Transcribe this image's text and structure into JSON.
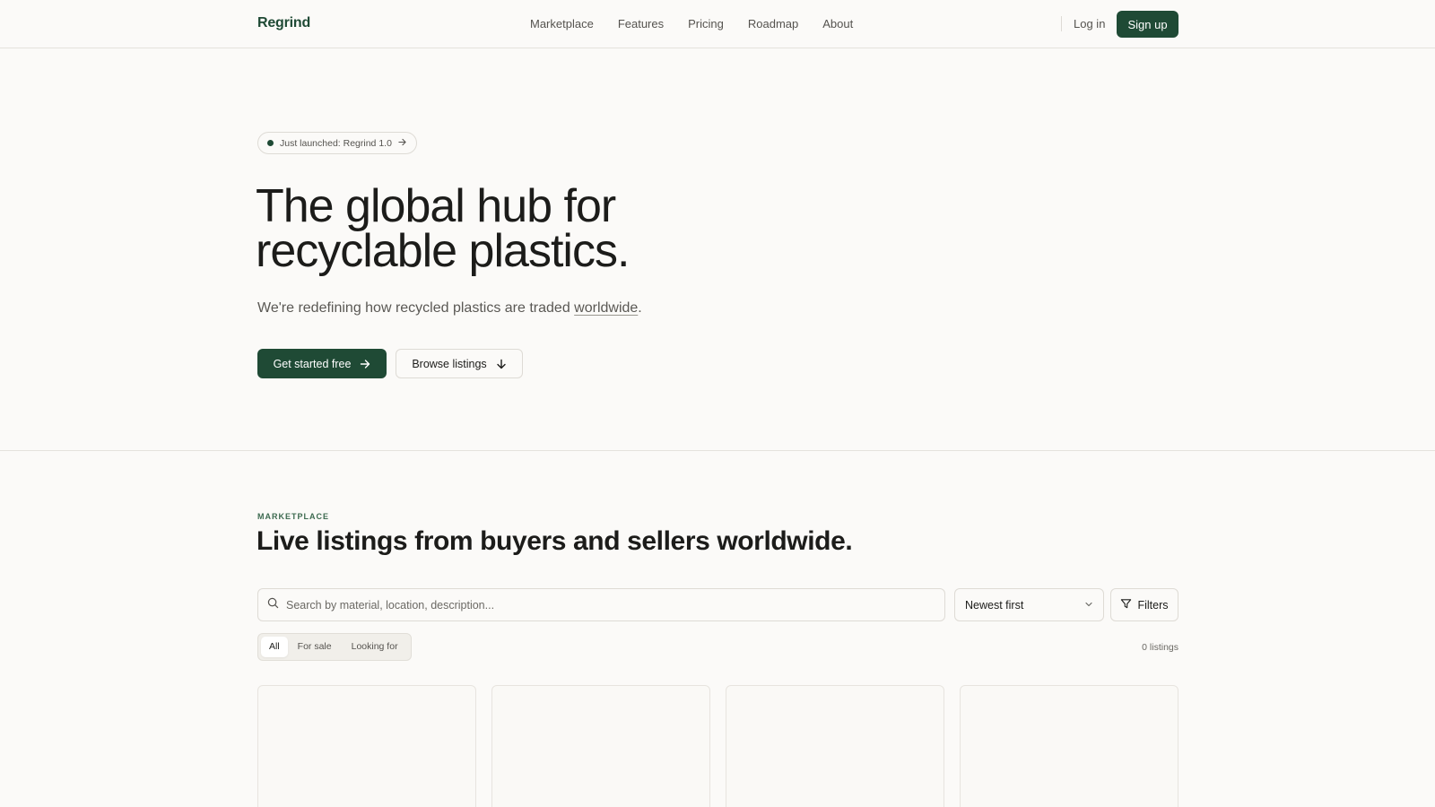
{
  "header": {
    "logo": "Regrind",
    "nav": [
      "Marketplace",
      "Features",
      "Pricing",
      "Roadmap",
      "About"
    ],
    "login_label": "Log in",
    "signup_label": "Sign up"
  },
  "hero": {
    "badge": "Just launched: Regrind 1.0",
    "title_line1": "The global hub for",
    "title_line2": "recyclable plastics.",
    "subtitle_prefix": "We're redefining how recycled plastics are traded ",
    "subtitle_link": "worldwide",
    "subtitle_suffix": ".",
    "primary_cta": "Get started free",
    "secondary_cta": "Browse listings"
  },
  "marketplace": {
    "eyebrow": "MARKETPLACE",
    "title": "Live listings from buyers and sellers worldwide.",
    "search_placeholder": "Search by material, location, description...",
    "sort_value": "Newest first",
    "filters_label": "Filters",
    "tabs": [
      "All",
      "For sale",
      "Looking for"
    ],
    "active_tab": "All",
    "count": "0 listings"
  },
  "icons": {
    "search": "search-icon",
    "chevron": "chevron-down-icon",
    "filter": "filter-icon",
    "arrow_right": "arrow-right-icon",
    "arrow_down": "arrow-down-icon"
  },
  "colors": {
    "brand": "#1f4a35",
    "background": "#fbfaf8",
    "border": "#dedbd5"
  }
}
